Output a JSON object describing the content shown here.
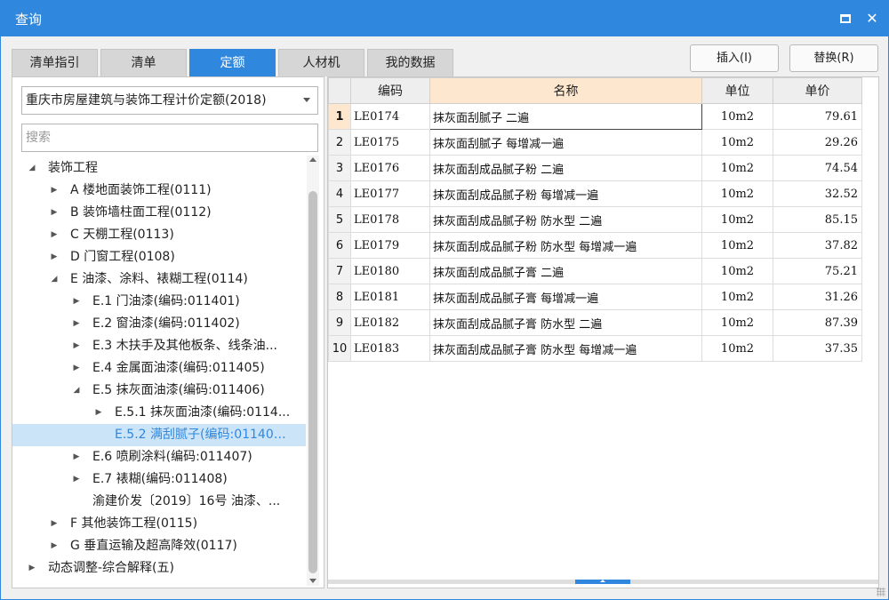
{
  "window": {
    "title": "查询",
    "maximize_label": "",
    "close_label": "✕"
  },
  "tabs": [
    {
      "label": "清单指引",
      "active": false
    },
    {
      "label": "清单",
      "active": false
    },
    {
      "label": "定额",
      "active": true
    },
    {
      "label": "人材机",
      "active": false
    },
    {
      "label": "我的数据",
      "active": false
    }
  ],
  "actions": {
    "insert_label": "插入(I)",
    "replace_label": "替换(R)"
  },
  "left": {
    "dropdown_value": "重庆市房屋建筑与装饰工程计价定额(2018)",
    "search_placeholder": "搜索",
    "tree": [
      {
        "label": "装饰工程",
        "expand": "expanded",
        "level": 0
      },
      {
        "label": "A 楼地面装饰工程(0111)",
        "expand": "collapsed",
        "level": 1
      },
      {
        "label": "B 装饰墙柱面工程(0112)",
        "expand": "collapsed",
        "level": 1
      },
      {
        "label": "C 天棚工程(0113)",
        "expand": "collapsed",
        "level": 1
      },
      {
        "label": "D 门窗工程(0108)",
        "expand": "collapsed",
        "level": 1
      },
      {
        "label": "E 油漆、涂料、裱糊工程(0114)",
        "expand": "expanded",
        "level": 1
      },
      {
        "label": "E.1 门油漆(编码:011401)",
        "expand": "collapsed",
        "level": 2
      },
      {
        "label": "E.2 窗油漆(编码:011402)",
        "expand": "collapsed",
        "level": 2
      },
      {
        "label": "E.3 木扶手及其他板条、线条油...",
        "expand": "collapsed",
        "level": 2
      },
      {
        "label": "E.4 金属面油漆(编码:011405)",
        "expand": "collapsed",
        "level": 2
      },
      {
        "label": "E.5 抹灰面油漆(编码:011406)",
        "expand": "expanded",
        "level": 2
      },
      {
        "label": "E.5.1 抹灰面油漆(编码:0114...",
        "expand": "collapsed",
        "level": 3
      },
      {
        "label": "E.5.2 满刮腻子(编码:011406...",
        "expand": "none",
        "level": 3,
        "selected": true
      },
      {
        "label": "E.6 喷刷涂料(编码:011407)",
        "expand": "collapsed",
        "level": 2
      },
      {
        "label": "E.7 裱糊(编码:011408)",
        "expand": "collapsed",
        "level": 2
      },
      {
        "label": "渝建价发〔2019〕16号 油漆、...",
        "expand": "none",
        "level": 2
      },
      {
        "label": "F 其他装饰工程(0115)",
        "expand": "collapsed",
        "level": 1
      },
      {
        "label": "G 垂直运输及超高降效(0117)",
        "expand": "collapsed",
        "level": 1
      },
      {
        "label": "动态调整-综合解释(五)",
        "expand": "collapsed",
        "level": 0
      }
    ]
  },
  "grid": {
    "columns": [
      "",
      "编码",
      "名称",
      "单位",
      "单价"
    ],
    "rows": [
      {
        "no": "1",
        "code": "LE0174",
        "name": "抹灰面刮腻子 二遍",
        "unit": "10m2",
        "price": "79.61"
      },
      {
        "no": "2",
        "code": "LE0175",
        "name": "抹灰面刮腻子 每增减一遍",
        "unit": "10m2",
        "price": "29.26"
      },
      {
        "no": "3",
        "code": "LE0176",
        "name": "抹灰面刮成品腻子粉 二遍",
        "unit": "10m2",
        "price": "74.54"
      },
      {
        "no": "4",
        "code": "LE0177",
        "name": "抹灰面刮成品腻子粉 每增减一遍",
        "unit": "10m2",
        "price": "32.52"
      },
      {
        "no": "5",
        "code": "LE0178",
        "name": "抹灰面刮成品腻子粉 防水型 二遍",
        "unit": "10m2",
        "price": "85.15"
      },
      {
        "no": "6",
        "code": "LE0179",
        "name": "抹灰面刮成品腻子粉 防水型 每增减一遍",
        "unit": "10m2",
        "price": "37.82"
      },
      {
        "no": "7",
        "code": "LE0180",
        "name": "抹灰面刮成品腻子膏 二遍",
        "unit": "10m2",
        "price": "75.21"
      },
      {
        "no": "8",
        "code": "LE0181",
        "name": "抹灰面刮成品腻子膏 每增减一遍",
        "unit": "10m2",
        "price": "31.26"
      },
      {
        "no": "9",
        "code": "LE0182",
        "name": "抹灰面刮成品腻子膏 防水型 二遍",
        "unit": "10m2",
        "price": "87.39"
      },
      {
        "no": "10",
        "code": "LE0183",
        "name": "抹灰面刮成品腻子膏 防水型 每增减一遍",
        "unit": "10m2",
        "price": "37.35"
      }
    ],
    "active_row": 0
  },
  "colors": {
    "accent": "#2f88dd",
    "selected_bg": "#cce4f7",
    "active_header": "#fde7cf"
  }
}
